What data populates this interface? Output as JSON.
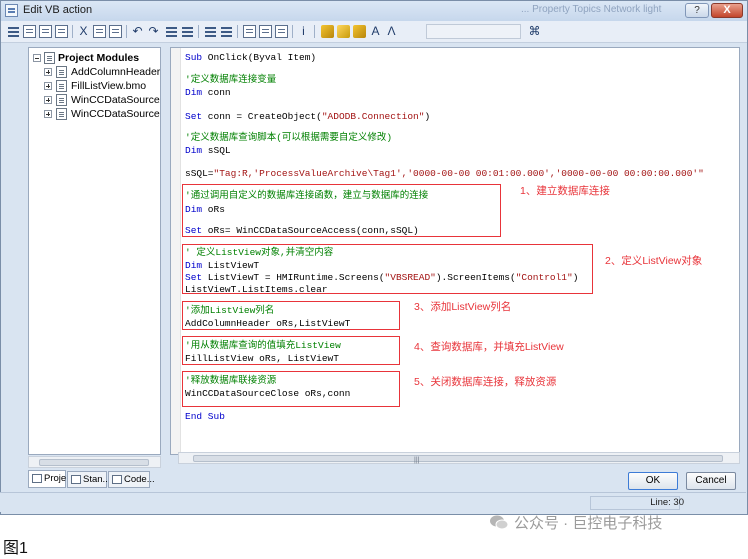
{
  "window": {
    "title": "Edit VB action",
    "background_title_ghost": "... Property Topics  Network light",
    "help_glyph": "?",
    "close_glyph": "X"
  },
  "toolbar": {
    "glyph_cut": "X",
    "glyph_undo": "↶",
    "glyph_redo": "↷",
    "glyph_info": "i",
    "glyph_font": "A",
    "glyph_lambda": "Λ",
    "glyph_page": "⌘"
  },
  "tree": {
    "root": "Project Modules",
    "items": [
      "AddColumnHeader.bm",
      "FillListView.bmo",
      "WinCCDataSourceAcc",
      "WinCCDataSourceClos"
    ]
  },
  "tabs": [
    "Proje...",
    "Stan...",
    "Code..."
  ],
  "code": {
    "l1_kw": "Sub",
    "l1_rest": " OnClick(Byval Item)",
    "l2": "'定义数据库连接变量",
    "l3_kw": "Dim",
    "l3_rest": " conn",
    "l4_kw": "Set",
    "l4_rest": " conn = CreateObject(",
    "l4_str": "\"ADODB.Connection\"",
    "l4_end": ")",
    "l5": "'定义数据库查询脚本(可以根据需要自定义修改)",
    "l6_kw": "Dim",
    "l6_rest": " sSQL",
    "l7_rest": "sSQL=",
    "l7_str": "\"Tag:R,'ProcessValueArchive\\Tag1','0000-00-00 00:01:00.000','0000-00-00 00:00:00.000'\"",
    "l8": "'通过调用自定义的数据库连接函数，建立与数据库的连接",
    "l9_kw": "Dim",
    "l9_rest": " oRs",
    "l10_kw": "Set",
    "l10_rest": " oRs= WinCCDataSourceAccess(conn,sSQL)",
    "l11": "' 定义ListView对象,并清空内容",
    "l12_kw": "Dim",
    "l12_rest": " ListViewT",
    "l13_kw": "Set",
    "l13_rest": " ListViewT = HMIRuntime.Screens(",
    "l13_str1": "\"VBSREAD\"",
    "l13_mid": ").ScreenItems(",
    "l13_str2": "\"Control1\"",
    "l13_end": ")",
    "l14": "ListViewT.ListItems.clear",
    "l15": "'添加ListView列名",
    "l16": "AddColumnHeader oRs,ListViewT",
    "l17": "'用从数据库查询的值填充ListView",
    "l18": "FillListView oRs, ListViewT",
    "l19": "'释放数据库联接资源",
    "l20": "WinCCDataSourceClose oRs,conn",
    "l21_kw": "End Sub"
  },
  "annotations": [
    "1、建立数据库连接",
    "2、定义ListView对象",
    "3、添加ListView列名",
    "4、查询数据库，并填充ListView",
    "5、关闭数据库连接，释放资源"
  ],
  "buttons": {
    "ok": "OK",
    "cancel": "Cancel"
  },
  "status": {
    "line": "Line: 30"
  },
  "caption": "图1",
  "watermark": "公众号 · 巨控电子科技",
  "colors": {
    "keyword": "#0000cc",
    "comment": "#008000",
    "string": "#a31515",
    "annotation": "#e8343a"
  }
}
